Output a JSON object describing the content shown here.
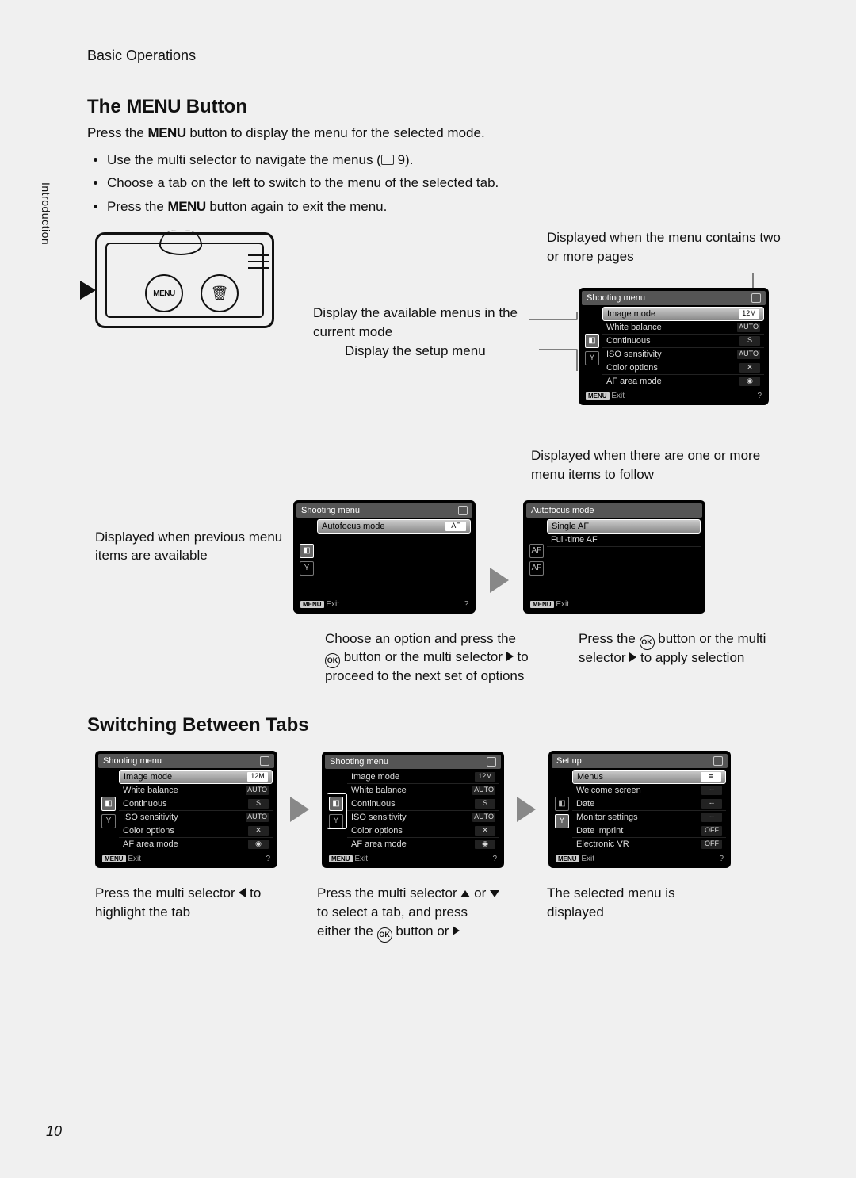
{
  "header": "Basic Operations",
  "side_tab": "Introduction",
  "title_the": "The",
  "menu_word": "MENU",
  "title_button": "Button",
  "intro_p1a": "Press the ",
  "intro_p1b": " button to display the menu for the selected mode.",
  "bullets": {
    "b1": "Use the multi selector to navigate the menus (",
    "b1_ref": "9).",
    "b2": "Choose a tab on the left to switch to the menu of the selected tab.",
    "b3a": "Press the ",
    "b3b": " button again to exit the menu."
  },
  "camera_labels": {
    "menu": "MENU"
  },
  "annotations": {
    "top1": "Displayed when the menu contains two or more pages",
    "mid1": "Display the available menus in the current mode",
    "mid2": "Display the setup menu",
    "more_below": "Displayed when there are one or more menu items to follow",
    "prev_avail": "Displayed when previous menu items are available",
    "choose_opt": "Choose an option and press the ",
    "choose_opt2": " button or the multi selector",
    "choose_opt3": " to proceed to the next set of options",
    "apply1": "Press the ",
    "apply2": " button or the multi selector",
    "apply3": " to apply selection"
  },
  "lcd1": {
    "title": "Shooting menu",
    "items": [
      {
        "label": "Image mode",
        "val": "12M"
      },
      {
        "label": "White balance",
        "val": "AUTO"
      },
      {
        "label": "Continuous",
        "val": "S"
      },
      {
        "label": "ISO sensitivity",
        "val": "AUTO"
      },
      {
        "label": "Color options",
        "val": "✕"
      },
      {
        "label": "AF area mode",
        "val": "◉"
      }
    ],
    "footer_exit": "Exit"
  },
  "lcd2": {
    "title": "Shooting menu",
    "items": [
      {
        "label": "Autofocus mode",
        "val": "AF"
      }
    ],
    "footer_exit": "Exit"
  },
  "lcd3": {
    "title": "Autofocus mode",
    "items": [
      {
        "label": "Single AF"
      },
      {
        "label": "Full-time AF"
      }
    ],
    "footer_exit": "Exit"
  },
  "h2_2": "Switching Between Tabs",
  "sw1": "Press the multi selector ",
  "sw1b": " to highlight the tab",
  "sw2": "Press the multi selector ",
  "sw2b": " or ",
  "sw2c": " to select a tab, and press either the ",
  "sw2d": " button or ",
  "sw3": "The selected menu is displayed",
  "lcd_setup": {
    "title": "Set up",
    "items": [
      {
        "label": "Menus",
        "val": "≡"
      },
      {
        "label": "Welcome screen",
        "val": "--"
      },
      {
        "label": "Date",
        "val": "--"
      },
      {
        "label": "Monitor settings",
        "val": "--"
      },
      {
        "label": "Date imprint",
        "val": "OFF"
      },
      {
        "label": "Electronic VR",
        "val": "OFF"
      }
    ],
    "footer_exit": "Exit"
  },
  "page_num": "10"
}
